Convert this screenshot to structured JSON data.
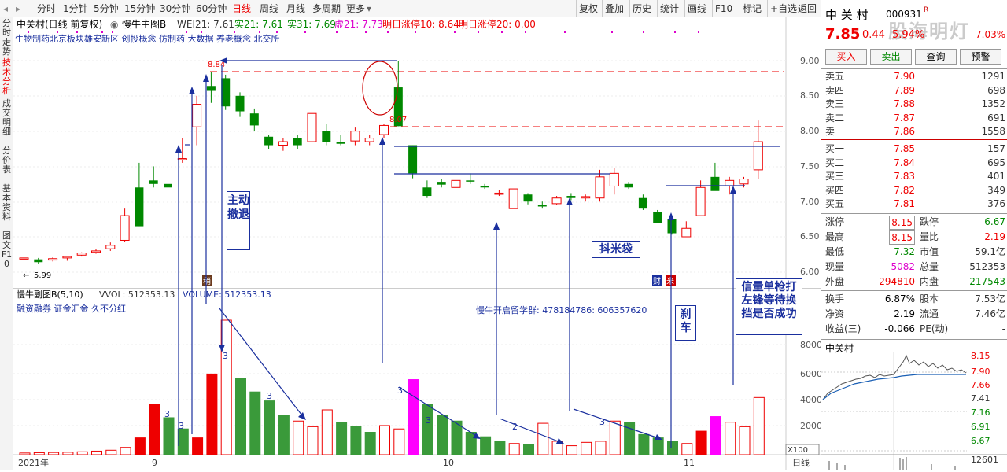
{
  "toolbar": {
    "periods": [
      "分时",
      "1分钟",
      "5分钟",
      "15分钟",
      "30分钟",
      "60分钟",
      "日线",
      "周线",
      "月线",
      "多周期",
      "更多"
    ],
    "active_period": "日线",
    "right": [
      "复权",
      "叠加",
      "历史",
      "统计",
      "画线",
      "F10",
      "标记",
      "+自选",
      "返回"
    ]
  },
  "left_tabs": [
    "分时走势",
    "技术分析",
    "成交明细",
    "分价表",
    "基本资料",
    "图文F10"
  ],
  "main_panel": {
    "title": "中关村(日线 前复权)",
    "indicator": "慢牛主图B",
    "wei21": "WEI21: 7.61",
    "shi21": "实21: 7.61",
    "shi31": "实31: 7.69",
    "xu21": "虚21: 7.73",
    "limit10": "明日涨停10: 8.64",
    "limit20": "明日涨停20: 0.00",
    "concepts": "生物制药北京板块雄安新区 创投概念 仿制药 大数据 养老概念 北交所",
    "price_axis": [
      "9.00",
      "8.50",
      "8.00",
      "7.50",
      "7.00",
      "6.50",
      "6.00"
    ],
    "high_label": "8.84",
    "low_label": "5.99",
    "mid_label": "8.07",
    "tags": [
      "稍",
      "财",
      "米"
    ]
  },
  "sub_panel": {
    "title": "慢牛副图B(5,10)",
    "vvol": "VVOL: 512353.13",
    "volume": "VOLUME: 512353.13",
    "line2": "融资融券 证金汇金 久不分红",
    "group": "慢牛开启留学群: 478184786: 606357620",
    "vol_axis": [
      "8000",
      "6000",
      "4000",
      "2000"
    ],
    "unit": "X100",
    "dates": [
      "2021年",
      "9",
      "10",
      "11"
    ],
    "period_label": "日线"
  },
  "annotations": {
    "a1": "主动撤退",
    "a2": "抖米袋",
    "a3": "刹车",
    "a4": "信量单枪打左锋等待换挡是否成功"
  },
  "stock": {
    "name": "中 关 村",
    "code": "000931",
    "badge": "R",
    "watermark": "股海明灯",
    "price": "7.85",
    "change": "0.44",
    "pct": "5.94%",
    "right_pct": "7.03%",
    "buttons": [
      "买入",
      "卖出",
      "查询",
      "预警"
    ],
    "sells": [
      {
        "label": "卖五",
        "price": "7.90",
        "vol": "1291"
      },
      {
        "label": "卖四",
        "price": "7.89",
        "vol": "698"
      },
      {
        "label": "卖三",
        "price": "7.88",
        "vol": "1352"
      },
      {
        "label": "卖二",
        "price": "7.87",
        "vol": "691"
      },
      {
        "label": "卖一",
        "price": "7.86",
        "vol": "1558"
      }
    ],
    "buys": [
      {
        "label": "买一",
        "price": "7.85",
        "vol": "157"
      },
      {
        "label": "买二",
        "price": "7.84",
        "vol": "695"
      },
      {
        "label": "买三",
        "price": "7.83",
        "vol": "401"
      },
      {
        "label": "买四",
        "price": "7.82",
        "vol": "349"
      },
      {
        "label": "买五",
        "price": "7.81",
        "vol": "376"
      }
    ],
    "stats": [
      {
        "l1": "涨停",
        "v1": "8.15",
        "l2": "跌停",
        "v2": "6.67"
      },
      {
        "l1": "最高",
        "v1": "8.15",
        "l2": "量比",
        "v2": "2.19"
      },
      {
        "l1": "最低",
        "v1": "7.32",
        "l2": "市值",
        "v2": "59.1亿"
      },
      {
        "l1": "现量",
        "v1": "5082",
        "l2": "总量",
        "v2": "512353"
      },
      {
        "l1": "外盘",
        "v1": "294810",
        "l2": "内盘",
        "v2": "217543"
      }
    ],
    "stats2": [
      {
        "l1": "换手",
        "v1": "6.87%",
        "l2": "股本",
        "v2": "7.53亿"
      },
      {
        "l1": "净资",
        "v1": "2.19",
        "l2": "流通",
        "v2": "7.46亿"
      },
      {
        "l1": "收益(三)",
        "v1": "-0.066",
        "l2": "PE(动)",
        "v2": "-"
      }
    ],
    "mini_title": "中关村",
    "mini_axis": [
      "8.15",
      "7.90",
      "7.66",
      "7.41",
      "7.16",
      "6.91",
      "6.67"
    ],
    "mini_vol": "12601"
  },
  "chart_data": {
    "type": "candlestick",
    "candles": [
      [
        6.2,
        6.22,
        6.19,
        6.2
      ],
      [
        6.18,
        6.2,
        6.12,
        6.14
      ],
      [
        6.17,
        6.21,
        6.15,
        6.19
      ],
      [
        6.2,
        6.23,
        6.16,
        6.22
      ],
      [
        6.24,
        6.28,
        6.22,
        6.27
      ],
      [
        6.28,
        6.33,
        6.26,
        6.3
      ],
      [
        6.33,
        6.42,
        6.3,
        6.38
      ],
      [
        6.45,
        6.9,
        6.43,
        6.8
      ],
      [
        7.2,
        7.55,
        6.65,
        6.65
      ],
      [
        7.3,
        7.5,
        7.2,
        7.25
      ],
      [
        7.25,
        7.3,
        7.1,
        7.2
      ],
      [
        7.6,
        7.9,
        7.55,
        7.61
      ],
      [
        8.06,
        8.5,
        7.8,
        8.38
      ],
      [
        8.64,
        8.84,
        8.4,
        8.57
      ],
      [
        8.75,
        8.8,
        8.3,
        8.35
      ],
      [
        8.5,
        8.55,
        8.2,
        8.28
      ],
      [
        8.25,
        8.32,
        8.0,
        8.08
      ],
      [
        7.92,
        7.95,
        7.75,
        7.8
      ],
      [
        7.8,
        7.9,
        7.72,
        7.85
      ],
      [
        7.9,
        7.95,
        7.75,
        7.8
      ],
      [
        7.85,
        8.3,
        7.82,
        8.25
      ],
      [
        8.0,
        8.1,
        7.8,
        7.85
      ],
      [
        7.84,
        7.95,
        7.8,
        7.82
      ],
      [
        7.86,
        8.05,
        7.8,
        8.0
      ],
      [
        7.85,
        7.95,
        7.8,
        7.9
      ],
      [
        7.95,
        8.1,
        7.9,
        8.08
      ],
      [
        8.62,
        9.0,
        8.07,
        8.07
      ],
      [
        7.8,
        7.8,
        7.33,
        7.4
      ],
      [
        7.2,
        7.3,
        7.05,
        7.08
      ],
      [
        7.28,
        7.32,
        7.2,
        7.24
      ],
      [
        7.2,
        7.35,
        7.18,
        7.3
      ],
      [
        7.3,
        7.4,
        7.25,
        7.29
      ],
      [
        7.22,
        7.25,
        7.18,
        7.2
      ],
      [
        7.12,
        7.16,
        7.08,
        7.12
      ],
      [
        6.9,
        7.18,
        6.9,
        7.18
      ],
      [
        7.1,
        7.12,
        6.96,
        7.0
      ],
      [
        6.95,
        7.0,
        6.9,
        6.93
      ],
      [
        6.97,
        7.08,
        6.95,
        7.05
      ],
      [
        7.08,
        7.12,
        7.02,
        7.05
      ],
      [
        7.05,
        7.1,
        7.0,
        7.07
      ],
      [
        7.05,
        7.45,
        7.0,
        7.35
      ],
      [
        7.22,
        7.48,
        7.1,
        7.4
      ],
      [
        7.25,
        7.28,
        7.18,
        7.2
      ],
      [
        7.05,
        7.1,
        6.88,
        6.9
      ],
      [
        6.85,
        6.88,
        6.7,
        6.7
      ],
      [
        6.75,
        6.8,
        6.53,
        6.55
      ],
      [
        6.5,
        6.72,
        6.5,
        6.62
      ],
      [
        6.8,
        7.3,
        6.8,
        7.2
      ],
      [
        7.35,
        7.55,
        7.18,
        7.15
      ],
      [
        7.22,
        7.35,
        7.1,
        7.3
      ],
      [
        7.25,
        7.35,
        7.2,
        7.32
      ],
      [
        7.45,
        8.15,
        7.32,
        7.85
      ]
    ],
    "volumes": [
      150,
      180,
      200,
      220,
      260,
      320,
      400,
      650,
      1500,
      4500,
      3300,
      2300,
      1500,
      7200,
      12000,
      6800,
      5600,
      4800,
      3500,
      3000,
      2500,
      4000,
      2900,
      2500,
      2000,
      2600,
      2300,
      6700,
      4500,
      3500,
      3000,
      2000,
      1600,
      1200,
      1000,
      900,
      2800,
      1200,
      800,
      1100,
      1200,
      3000,
      2900,
      1800,
      1500,
      1200,
      1000,
      2100,
      3400,
      2900,
      2500,
      5100
    ],
    "volume_colors": [
      "h",
      "h",
      "h",
      "h",
      "h",
      "h",
      "h",
      "h",
      "r",
      "r",
      "g",
      "g",
      "r",
      "r",
      "h",
      "g",
      "g",
      "g",
      "g",
      "h",
      "h",
      "h",
      "g",
      "g",
      "g",
      "h",
      "h",
      "m",
      "g",
      "g",
      "g",
      "g",
      "g",
      "g",
      "h",
      "g",
      "h",
      "h",
      "h",
      "h",
      "h",
      "h",
      "g",
      "g",
      "g",
      "g",
      "h",
      "r",
      "m",
      "h",
      "h",
      "h"
    ]
  }
}
